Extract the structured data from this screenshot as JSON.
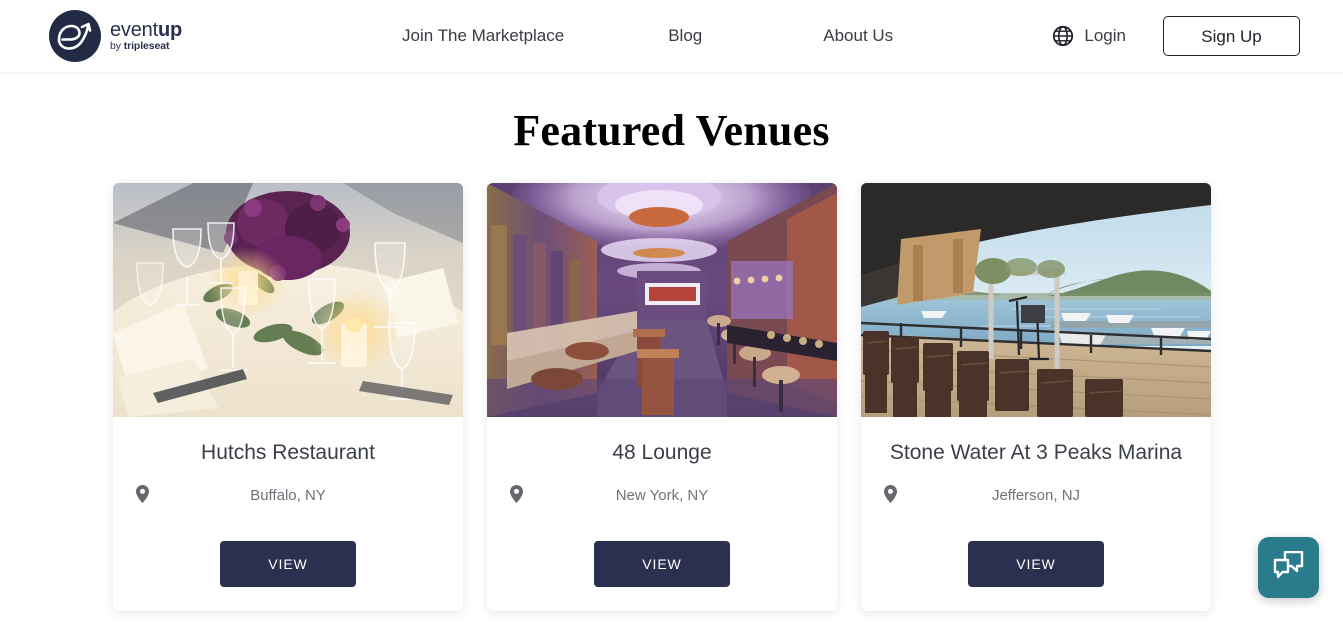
{
  "header": {
    "logo": {
      "name_part1": "event",
      "name_part2": "up",
      "tagline_prefix": "by ",
      "tagline_brand": "tripleseat",
      "icon": "eventup-logo-icon"
    },
    "nav": [
      {
        "label": "Join The Marketplace"
      },
      {
        "label": "Blog"
      },
      {
        "label": "About Us"
      }
    ],
    "login_label": "Login",
    "login_icon": "globe-icon",
    "signup_label": "Sign Up"
  },
  "main": {
    "title": "Featured Venues",
    "location_icon": "map-pin-icon",
    "cards": [
      {
        "title": "Hutchs Restaurant",
        "location": "Buffalo, NY",
        "button_label": "VIEW",
        "image_alt": "candlelit banquet table with purple floral centerpiece and wine glasses"
      },
      {
        "title": "48 Lounge",
        "location": "New York, NY",
        "button_label": "VIEW",
        "image_alt": "purple-lit lounge interior with bar stools and seating"
      },
      {
        "title": "Stone Water At 3 Peaks Marina",
        "location": "Jefferson, NJ",
        "button_label": "VIEW",
        "image_alt": "waterfront marina deck with chairs facing a lake and wedding arch"
      }
    ]
  },
  "chat": {
    "label": "Chat",
    "icon": "chat-bubbles-icon",
    "color": "#2a7b8c"
  },
  "colors": {
    "brand_navy": "#2b3050",
    "text_dark": "#3b3b43",
    "text_muted": "#6f7278",
    "chat_teal": "#2a7b8c"
  }
}
